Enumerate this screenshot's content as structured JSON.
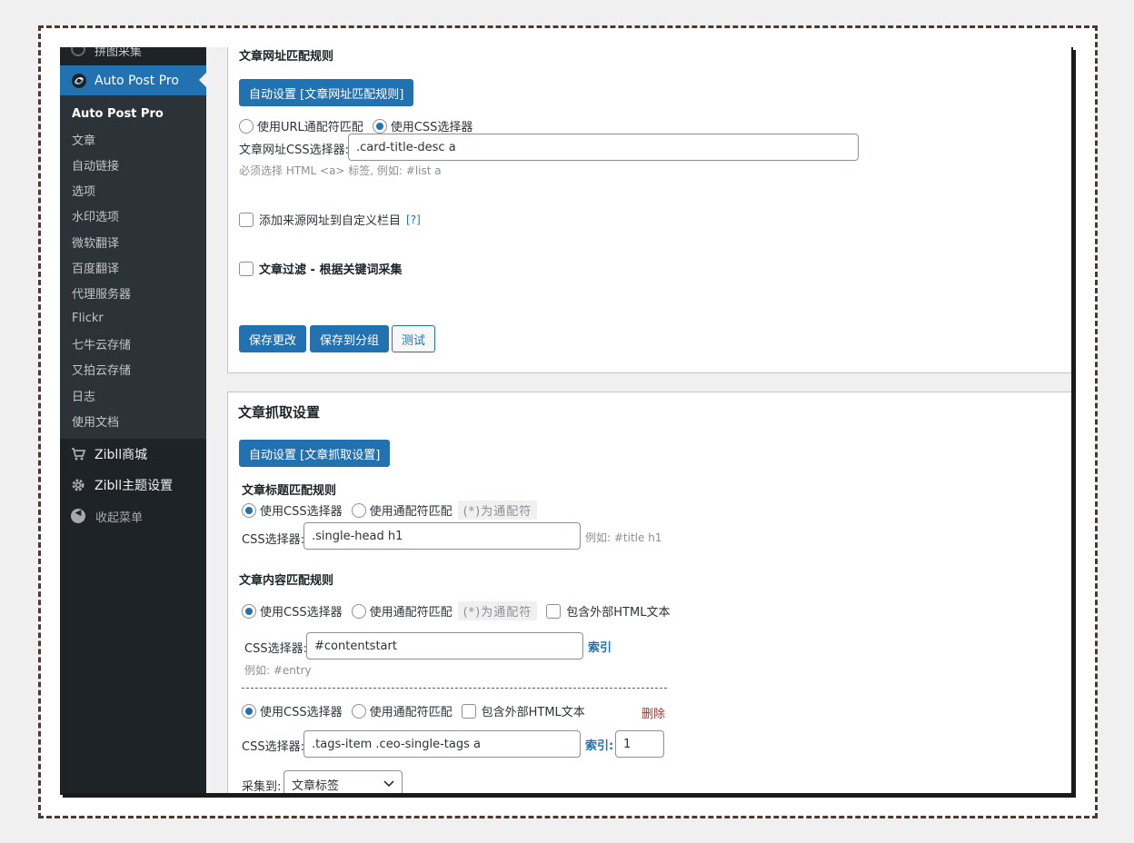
{
  "sidebar": {
    "top_partial_label": "拼图采集",
    "active_plugin": "Auto Post Pro",
    "submenu": [
      "Auto Post Pro",
      "文章",
      "自动链接",
      "选项",
      "水印选项",
      "微软翻译",
      "百度翻译",
      "代理服务器",
      "Flickr",
      "七牛云存储",
      "又拍云存储",
      "日志",
      "使用文档"
    ],
    "menu": [
      {
        "label": "Zibll商城",
        "icon": "cart-icon"
      },
      {
        "label": "Zibll主题设置",
        "icon": "gear-icon"
      }
    ],
    "collapse_label": "收起菜单"
  },
  "url_rules": {
    "heading": "文章网址匹配规则",
    "auto_button": "自动设置 [文章网址匹配规则]",
    "radio_url_wildcard": "使用URL通配符匹配",
    "radio_css": "使用CSS选择器",
    "css_label": "文章网址CSS选择器:",
    "css_value": ".card-title-desc a",
    "css_desc": "必须选择 HTML <a> 标签, 例如: #list a",
    "add_source_label": "添加来源网址到自定义栏目",
    "help_link": "[?]",
    "filter_label": "文章过滤 - 根据关键词采集",
    "save_button": "保存更改",
    "save_group_button": "保存到分组",
    "test_button": "测试"
  },
  "scrape": {
    "heading": "文章抓取设置",
    "auto_button": "自动设置 [文章抓取设置]",
    "title_rules": {
      "heading": "文章标题匹配规则",
      "radio_css": "使用CSS选择器",
      "radio_wildcard": "使用通配符匹配",
      "wildcard_hint": "(*)为通配符",
      "css_label": "CSS选择器:",
      "css_value": ".single-head h1",
      "example": "例如: #title h1"
    },
    "content_rules": {
      "heading": "文章内容匹配规则",
      "radio_css": "使用CSS选择器",
      "radio_wildcard": "使用通配符匹配",
      "wildcard_hint": "(*)为通配符",
      "include_html": "包含外部HTML文本",
      "css_label": "CSS选择器:",
      "css_value": "#contentstart",
      "index_link": "索引",
      "example": "例如: #entry"
    },
    "extra_rule": {
      "radio_css": "使用CSS选择器",
      "radio_wildcard": "使用通配符匹配",
      "include_html": "包含外部HTML文本",
      "delete_link": "删除",
      "css_label": "CSS选择器:",
      "css_value": ".tags-item .ceo-single-tags a",
      "index_label": "索引:",
      "index_value": "1",
      "collect_to_label": "采集到:",
      "collect_to_value": "文章标签"
    }
  },
  "colors": {
    "primary": "#2271b1",
    "sidebar_bg": "#1d2327",
    "submenu_bg": "#2c3338",
    "danger": "#b32d2e"
  }
}
